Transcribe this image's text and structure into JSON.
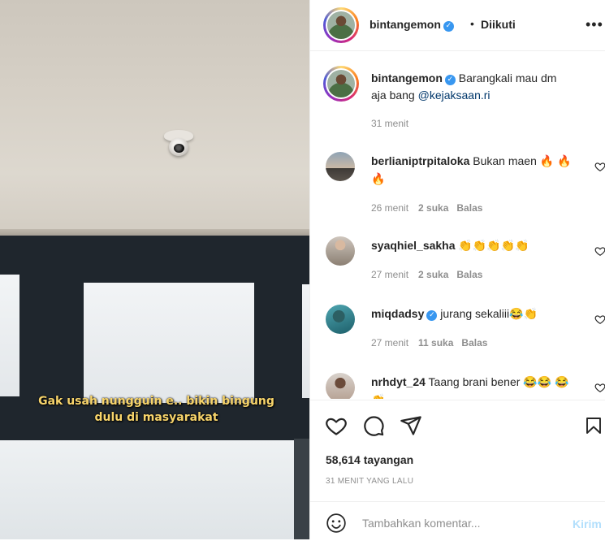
{
  "video": {
    "caption_line1": "Gak usah nungguin e.. bikin bingung",
    "caption_line2": "dulu di masyarakat"
  },
  "header": {
    "username": "bintangemon",
    "verified_mark": "✓",
    "separator": "•",
    "follow_status": "Diikuti",
    "more_icon": "•••"
  },
  "post_caption": {
    "username": "bintangemon",
    "text": " Barangkali mau dm aja bang ",
    "mention": "@kejaksaan.ri",
    "time": "31 menit"
  },
  "comments": [
    {
      "username": "berlianiptrpitaloka",
      "text": " Bukan maen 🔥 🔥🔥",
      "time": "26 menit",
      "likes": "2 suka",
      "reply": "Balas",
      "verified": false
    },
    {
      "username": "syaqhiel_sakha",
      "text": " 👏👏👏👏👏",
      "time": "27 menit",
      "likes": "2 suka",
      "reply": "Balas",
      "verified": false
    },
    {
      "username": "miqdadsy",
      "text": " jurang sekaliii😂👏",
      "time": "27 menit",
      "likes": "11 suka",
      "reply": "Balas",
      "verified": true
    },
    {
      "username": "nrhdyt_24",
      "text": " Taang brani bener 😂😂 😂👏",
      "time": "",
      "likes": "",
      "reply": "",
      "verified": false
    }
  ],
  "stats": {
    "views": "58,614 tayangan",
    "posted_ago": "31 MENIT YANG LALU"
  },
  "add_comment": {
    "placeholder": "Tambahkan komentar...",
    "post_label": "Kirim"
  },
  "colors": {
    "verified": "#3897f0",
    "mention": "#00376b",
    "muted": "#8e8e8e",
    "post_button": "#b2dffc",
    "caption_yellow": "#f7d46b"
  },
  "icons": [
    "heart-icon",
    "comment-icon",
    "share-icon",
    "bookmark-icon",
    "smile-icon",
    "more-icon"
  ]
}
